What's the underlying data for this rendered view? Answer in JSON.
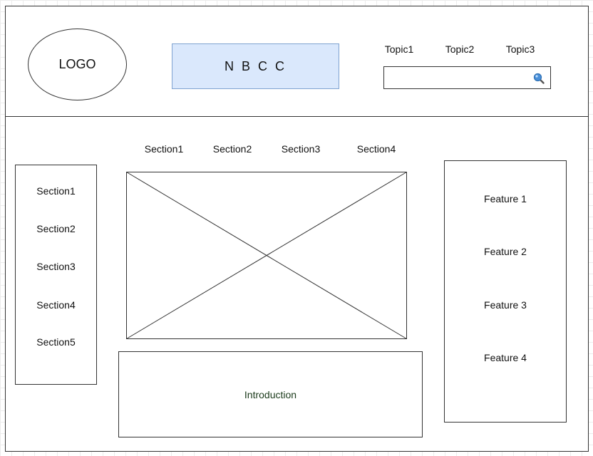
{
  "header": {
    "logo_text": "LOGO",
    "brand_text": "N B C C",
    "topics": [
      {
        "label": "Topic1"
      },
      {
        "label": "Topic2"
      },
      {
        "label": "Topic3"
      }
    ],
    "search": {
      "value": "",
      "placeholder": "",
      "icon": "search-icon"
    }
  },
  "top_nav": {
    "sections": [
      {
        "label": "Section1"
      },
      {
        "label": "Section2"
      },
      {
        "label": "Section3"
      },
      {
        "label": "Section4"
      }
    ]
  },
  "left_nav": {
    "sections": [
      {
        "label": "Section1"
      },
      {
        "label": "Section2"
      },
      {
        "label": "Section3"
      },
      {
        "label": "Section4"
      },
      {
        "label": "Section5"
      }
    ]
  },
  "main": {
    "introduction_label": "Introduction"
  },
  "features": {
    "items": [
      {
        "label": "Feature 1"
      },
      {
        "label": "Feature 2"
      },
      {
        "label": "Feature 3"
      },
      {
        "label": "Feature 4"
      }
    ]
  },
  "colors": {
    "brand_fill": "#dae8fc",
    "brand_border": "#7fa3d0",
    "line": "#333333"
  }
}
